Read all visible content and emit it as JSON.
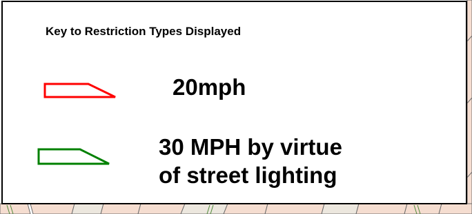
{
  "legend": {
    "title": "Key to Restriction Types Displayed",
    "items": [
      {
        "symbol": "red-open-wedge",
        "color": "#ff0000",
        "label": "20mph"
      },
      {
        "symbol": "green-open-wedge",
        "color": "#008000",
        "label_lines": [
          "30 MPH by virtue",
          "of street lighting"
        ]
      }
    ]
  },
  "map": {
    "parcel_fill": "#f5ddd0",
    "road_fill": "#ece7de",
    "line_color": "#6b6b6b"
  }
}
